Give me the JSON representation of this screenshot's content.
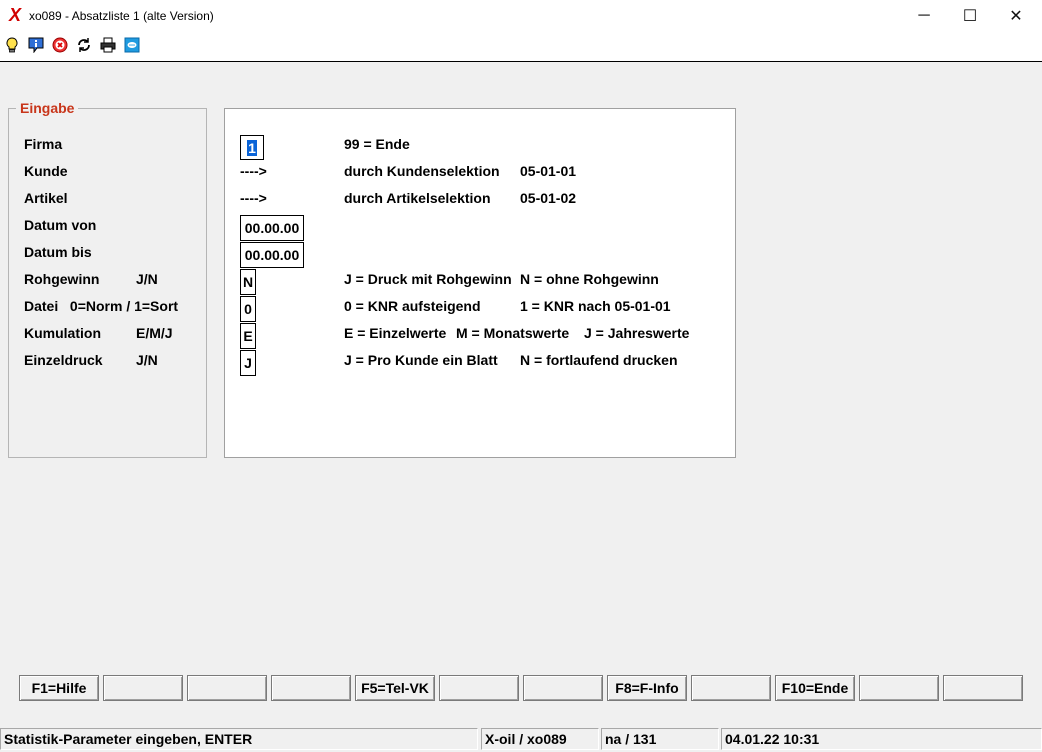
{
  "window": {
    "logo": "X",
    "title": "xo089 - Absatzliste 1 (alte Version)",
    "minimize": "─",
    "maximize": "☐",
    "close": "✕"
  },
  "toolbar": {
    "icons": [
      "lightbulb-icon",
      "info-icon",
      "cancel-icon",
      "refresh-icon",
      "print-icon",
      "chat-icon"
    ]
  },
  "group": {
    "legend": "Eingabe",
    "labels": [
      {
        "text": "Firma",
        "suffix": ""
      },
      {
        "text": "Kunde",
        "suffix": ""
      },
      {
        "text": "Artikel",
        "suffix": ""
      },
      {
        "text": "Datum von",
        "suffix": ""
      },
      {
        "text": "Datum bis",
        "suffix": ""
      },
      {
        "text": "Rohgewinn",
        "suffix": "J/N"
      },
      {
        "text": "Datei   0=Norm / 1=Sort",
        "suffix": ""
      },
      {
        "text": "Kumulation",
        "suffix": "E/M/J"
      },
      {
        "text": "Einzeldruck",
        "suffix": "J/N"
      }
    ]
  },
  "fields": {
    "firma": "1",
    "kunde_arrow": "---->",
    "artikel_arrow": "---->",
    "datum_von": "00.00.00",
    "datum_bis": "00.00.00",
    "rohgewinn": "N",
    "datei": "0",
    "kumulation": "E",
    "einzeldruck": "J"
  },
  "hints": {
    "firma": "99 = Ende",
    "kunde": "durch Kundenselektion",
    "kunde_code": "05-01-01",
    "artikel": "durch Artikelselektion",
    "artikel_code": "05-01-02",
    "rohgewinn_a": "J = Druck mit Rohgewinn",
    "rohgewinn_b": "N = ohne Rohgewinn",
    "datei_a": "0 = KNR aufsteigend",
    "datei_b": "1 = KNR nach 05-01-01",
    "kumulation_a": "E = Einzelwerte",
    "kumulation_b": "M = Monatswerte",
    "kumulation_c": "J = Jahreswerte",
    "einzeldruck_a": "J = Pro Kunde ein Blatt",
    "einzeldruck_b": "N = fortlaufend drucken"
  },
  "function_keys": [
    "F1=Hilfe",
    "",
    "",
    "",
    "F5=Tel-VK",
    "",
    "",
    "F8=F-Info",
    "",
    "F10=Ende",
    "",
    ""
  ],
  "status_bar": {
    "message": "Statistik-Parameter eingeben, ENTER",
    "program": "X-oil / xo089",
    "user": "na / 131",
    "datetime": "04.01.22 10:31"
  }
}
